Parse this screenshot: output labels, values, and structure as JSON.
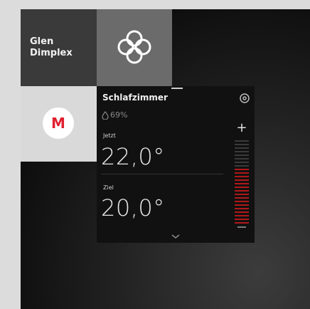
{
  "tiles": {
    "glen": {
      "label": "Glen\nDimplex"
    },
    "knot": {
      "icon": "celtic-knot-icon"
    },
    "m": {
      "label": "M",
      "color": "#e02030"
    }
  },
  "thermostat": {
    "room": "Schlafzimmer",
    "humidity": "69%",
    "now_label": "Jetzt",
    "now_value": "22,0°",
    "target_label": "Ziel",
    "target_value": "20,0°",
    "plus": "+",
    "level_total": 24,
    "level_active": 16,
    "active_color": "#b01818",
    "inactive_color": "#3a3a3a"
  }
}
